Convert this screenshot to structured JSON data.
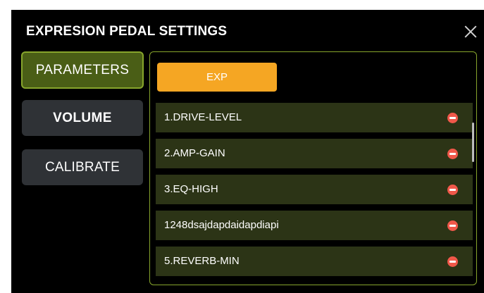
{
  "dialog": {
    "title": "EXPRESION PEDAL SETTINGS",
    "close_icon": "close-icon"
  },
  "sidebar": {
    "items": [
      {
        "label": "PARAMETERS",
        "active": true
      },
      {
        "label": "VOLUME",
        "active": false
      },
      {
        "label": "CALIBRATE",
        "active": false
      }
    ]
  },
  "panel": {
    "exp_button_label": "EXP",
    "parameters": [
      {
        "label": "1.DRIVE-LEVEL"
      },
      {
        "label": "2.AMP-GAIN"
      },
      {
        "label": "3.EQ-HIGH"
      },
      {
        "label": "1248dsajdapdaidapdiapi"
      },
      {
        "label": "5.REVERB-MIN"
      }
    ]
  },
  "colors": {
    "background": "#000000",
    "accent_green": "#87a52c",
    "active_fill": "#4a5e16",
    "row_fill": "#2c3416",
    "exp_orange": "#f5a623",
    "remove_red": "#f0584a",
    "inactive_button": "#2f3236"
  }
}
